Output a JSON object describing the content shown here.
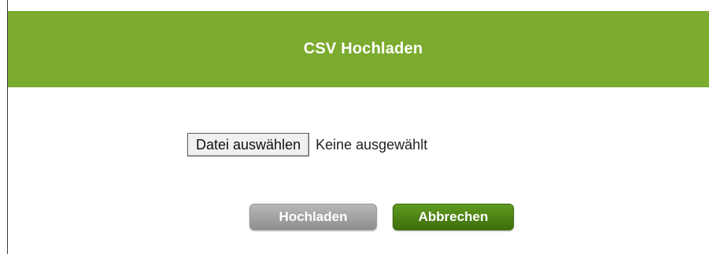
{
  "dialog": {
    "title": "CSV Hochladen",
    "header_color": "#7bab2f"
  },
  "file_input": {
    "button_label": "Datei auswählen",
    "status_text": "Keine ausgewählt"
  },
  "actions": {
    "upload_label": "Hochladen",
    "cancel_label": "Abbrechen",
    "upload_color": "#a3a3a3",
    "cancel_color": "#4d8415"
  }
}
